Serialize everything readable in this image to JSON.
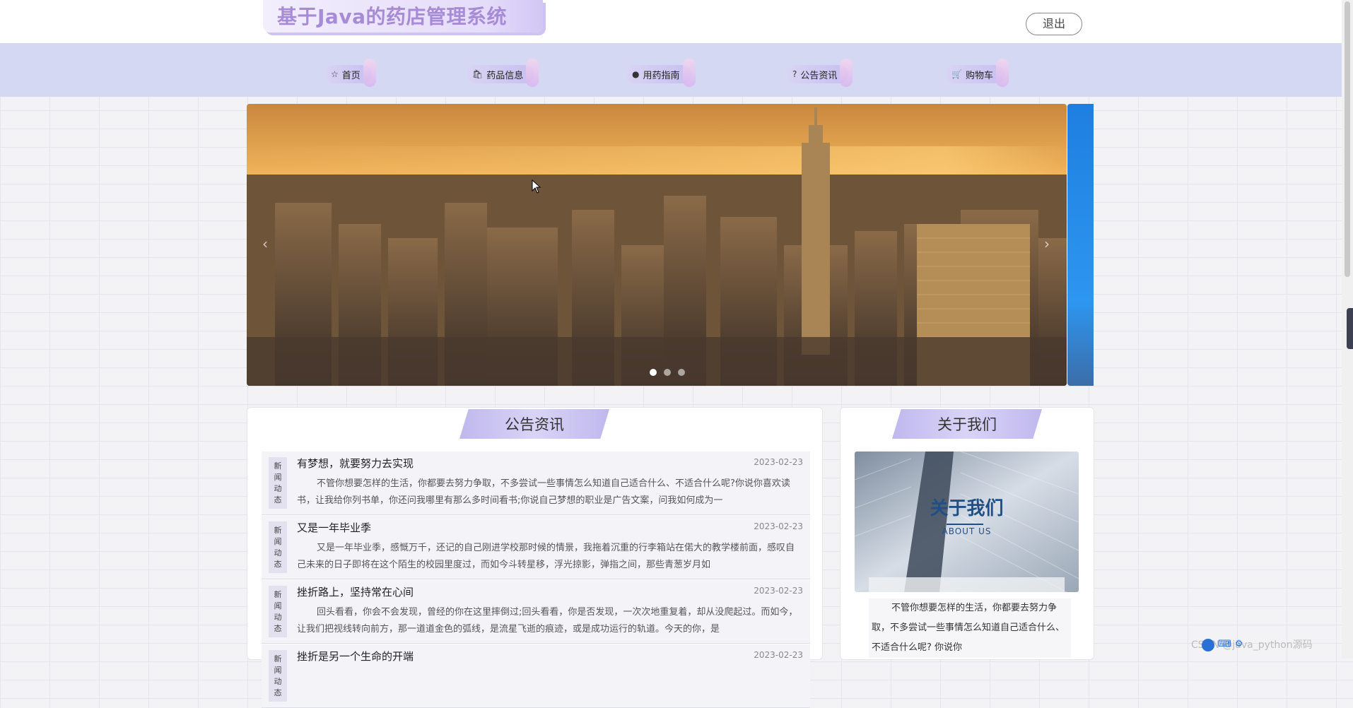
{
  "header": {
    "site_title": "基于Java的药店管理系统",
    "logout_label": "退出"
  },
  "nav": {
    "items": [
      {
        "label": "首页",
        "icon": "star-icon"
      },
      {
        "label": "药品信息",
        "icon": "bag-icon"
      },
      {
        "label": "用药指南",
        "icon": "info-icon"
      },
      {
        "label": "公告资讯",
        "icon": "question-icon"
      },
      {
        "label": "购物车",
        "icon": "cart-icon"
      }
    ]
  },
  "carousel": {
    "slide_count": 3,
    "active_index": 0
  },
  "news": {
    "heading": "公告资讯",
    "items": [
      {
        "tag": [
          "新",
          "闻",
          "动",
          "态"
        ],
        "title": "有梦想，就要努力去实现",
        "date": "2023-02-23",
        "body": "不管你想要怎样的生活，你都要去努力争取，不多尝试一些事情怎么知道自己适合什么、不适合什么呢?你说你喜欢读书，让我给你列书单，你还问我哪里有那么多时间看书;你说自己梦想的职业是广告文案，问我如何成为一"
      },
      {
        "tag": [
          "新",
          "闻",
          "动",
          "态"
        ],
        "title": "又是一年毕业季",
        "date": "2023-02-23",
        "body": "又是一年毕业季，感慨万千，还记的自己刚进学校那时候的情景，我拖着沉重的行李箱站在偌大的教学楼前面，感叹自己未来的日子即将在这个陌生的校园里度过，而如今斗转星移，浮光掠影，弹指之间，那些青葱岁月如"
      },
      {
        "tag": [
          "新",
          "闻",
          "动",
          "态"
        ],
        "title": "挫折路上，坚持常在心间",
        "date": "2023-02-23",
        "body": "回头看看，你会不会发现，曾经的你在这里摔倒过;回头看看，你是否发现，一次次地重复着，却从没爬起过。而如今，让我们把视线转向前方，那一道道金色的弧线，是流星飞逝的痕迹，或是成功运行的轨道。今天的你，是"
      },
      {
        "tag": [
          "新",
          "闻",
          "动",
          "态"
        ],
        "title": "挫折是另一个生命的开端",
        "date": "2023-02-23",
        "body": ""
      }
    ]
  },
  "about": {
    "heading": "关于我们",
    "image_title": "关于我们",
    "image_subtitle": "ABOUT US",
    "text": "不管你想要怎样的生活，你都要去努力争取，不多尝试一些事情怎么知道自己适合什么、不适合什么呢? 你说你"
  },
  "overlay": {
    "watermark": "CSDN @java_python源码"
  }
}
